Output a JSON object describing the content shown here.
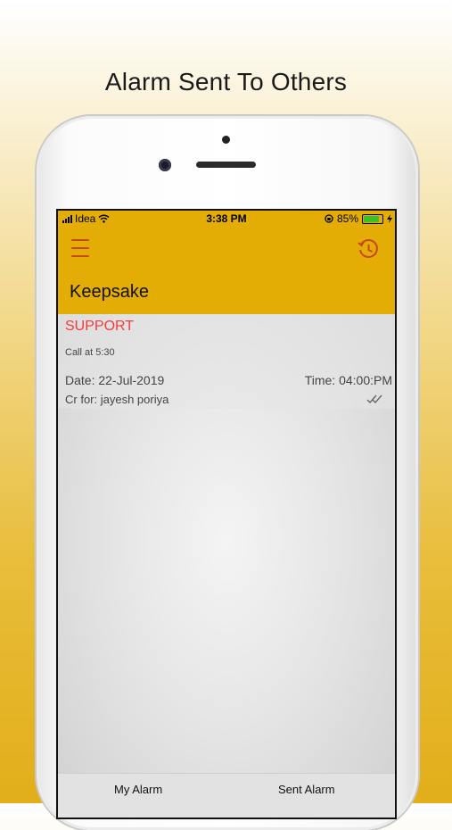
{
  "headline": "Alarm Sent To Others",
  "status_bar": {
    "carrier": "Idea",
    "time": "3:38 PM",
    "battery_percent": "85%",
    "battery_level": 0.85
  },
  "app_bar": {
    "title": "Keepsake",
    "menu_icon": "hamburger-menu-icon",
    "history_icon": "history-clock-icon"
  },
  "alarms": [
    {
      "title": "SUPPORT",
      "description": "Call at 5:30",
      "date": "Date:  22-Jul-2019",
      "time": "Time: 04:00:PM",
      "created_for": "Cr for: jayesh poriya",
      "status_icon": "double-check-icon"
    }
  ],
  "tabs": [
    {
      "label": "My Alarm"
    },
    {
      "label": "Sent Alarm"
    }
  ],
  "colors": {
    "accent": "#e3ad05",
    "alarm_title": "#f23c3c",
    "icon": "#c8461c",
    "battery": "#39c12a"
  }
}
